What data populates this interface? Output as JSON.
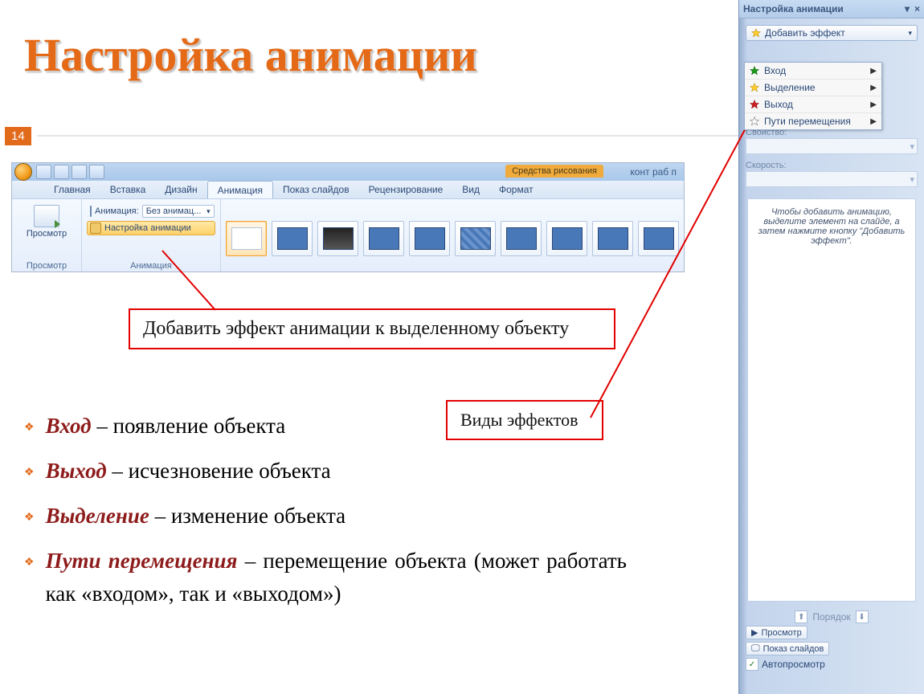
{
  "slide": {
    "title": "Настройка анимации",
    "page_number": "14"
  },
  "ribbon": {
    "ctx_tab": "Средства рисования",
    "doc_title": "конт раб п",
    "tabs": [
      "Главная",
      "Вставка",
      "Дизайн",
      "Анимация",
      "Показ слайдов",
      "Рецензирование",
      "Вид",
      "Формат"
    ],
    "active_tab_index": 3,
    "group_preview": {
      "btn": "Просмотр",
      "label": "Просмотр"
    },
    "group_anim": {
      "row1_label": "Анимация:",
      "row1_value": "Без анимац...",
      "row2_label": "Настройка анимации",
      "label": "Анимация"
    }
  },
  "pane": {
    "title": "Настройка анимации",
    "add_effect_btn": "Добавить эффект",
    "menu": [
      {
        "label": "Вход",
        "star": "#1a7a1a"
      },
      {
        "label": "Выделение",
        "star": "#d7b400"
      },
      {
        "label": "Выход",
        "star": "#b00000"
      },
      {
        "label": "Пути перемещения",
        "star": "#ffffff"
      }
    ],
    "field_property": "Свойство:",
    "field_speed": "Скорость:",
    "hint": "Чтобы добавить анимацию, выделите элемент на слайде, а затем нажмите кнопку \"Добавить эффект\".",
    "order_label": "Порядок",
    "btn_preview": "Просмотр",
    "btn_slideshow": "Показ слайдов",
    "chk_autopreview": "Автопросмотр"
  },
  "callouts": {
    "main": "Добавить эффект анимации к выделенному объекту",
    "types": "Виды эффектов"
  },
  "bullets": [
    {
      "term": "Вход",
      "rest": " – появление объекта"
    },
    {
      "term": "Выход",
      "rest": " – исчезновение объекта"
    },
    {
      "term": "Выделение",
      "rest": " – изменение объекта"
    },
    {
      "term": "Пути перемещения",
      "rest": " – перемещение объекта (может работать как «входом», так и «выходом»)"
    }
  ]
}
